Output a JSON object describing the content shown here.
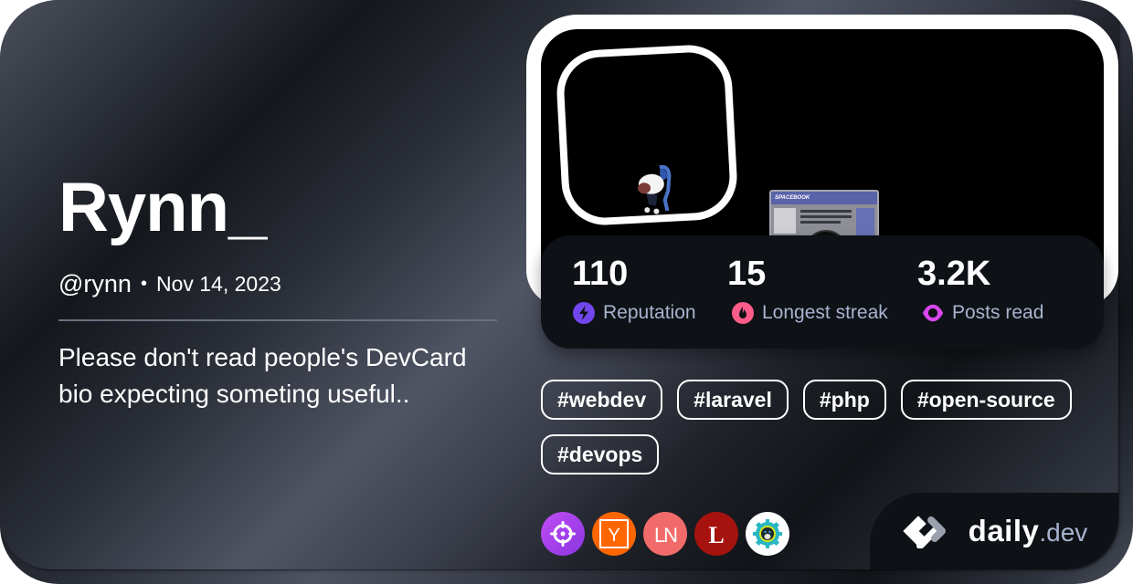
{
  "profile": {
    "name": "Rynn_",
    "handle": "@rynn",
    "separator": "•",
    "joined": "Nov 14, 2023",
    "bio": "Please don't read people's DevCard bio expecting someting useful.."
  },
  "cover": {
    "avatar_icon": "avatar-image",
    "cover_image_icon": "cover-image",
    "spacebook_title": "SPACEBOOK"
  },
  "stats": [
    {
      "value": "110",
      "label": "Reputation",
      "icon": "lightning-icon",
      "color": "#7147ed"
    },
    {
      "value": "15",
      "label": "Longest streak",
      "icon": "flame-icon",
      "color": "#ff5c8a"
    },
    {
      "value": "3.2K",
      "label": "Posts read",
      "icon": "eye-icon",
      "color": "#d946ef"
    }
  ],
  "tags": [
    "#webdev",
    "#laravel",
    "#php",
    "#open-source",
    "#devops"
  ],
  "sources": [
    {
      "name": "crosshair-source",
      "color": "#9b3dec"
    },
    {
      "name": "hacker-news-source",
      "label": "Y",
      "color": "#ff6600"
    },
    {
      "name": "laravel-news-source",
      "label": "LN",
      "color": "#f26b6b"
    },
    {
      "name": "laracasts-source",
      "label": "L",
      "color": "#a6130f"
    },
    {
      "name": "linux-source",
      "color": "#ffffff"
    }
  ],
  "brand": {
    "name": "daily",
    "tld": ".dev"
  },
  "colors": {
    "stats_bg": "#0e1116",
    "label_text": "#a8b3cf",
    "reputation": "#7147ed",
    "streak": "#ff5c8a",
    "posts_read": "#d946ef"
  }
}
